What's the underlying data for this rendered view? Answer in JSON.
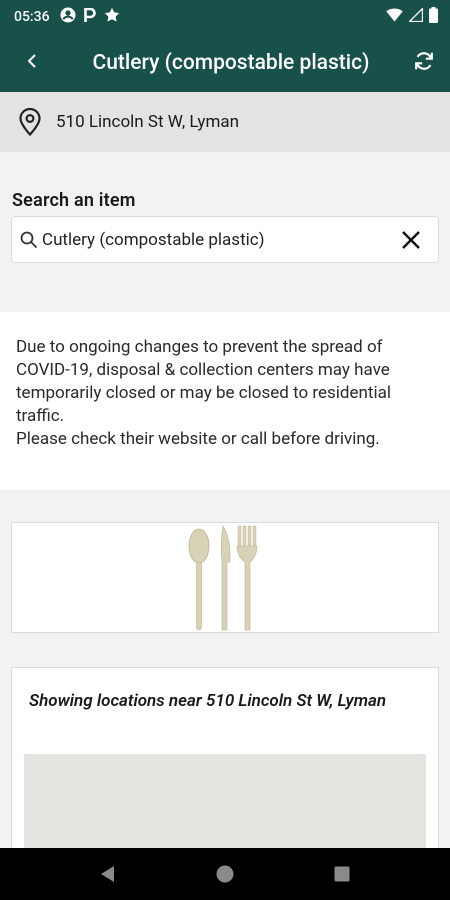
{
  "status_bar": {
    "time": "05:36",
    "left_icons": [
      "account-circle-icon",
      "parking-icon",
      "star-icon"
    ],
    "right_icons": [
      "wifi-icon",
      "signal-icon",
      "battery-icon"
    ]
  },
  "app_bar": {
    "title": "Cutlery (compostable plastic)",
    "background_color": "#17514a"
  },
  "address": {
    "text": "510 Lincoln St W, Lyman"
  },
  "search": {
    "label": "Search an item",
    "value": "Cutlery (compostable plastic)"
  },
  "notice": {
    "line1": "Due to ongoing changes to prevent the spread of COVID-19, disposal & collection centers may have temporarily closed or may be closed to residential traffic.",
    "line2": "Please check their website or call before driving."
  },
  "item_image": {
    "icon": "cutlery-image"
  },
  "locations": {
    "heading": "Showing locations near 510 Lincoln St W, Lyman"
  },
  "nav_bar": {
    "buttons": [
      "back-triangle",
      "home-circle",
      "recents-square"
    ]
  }
}
